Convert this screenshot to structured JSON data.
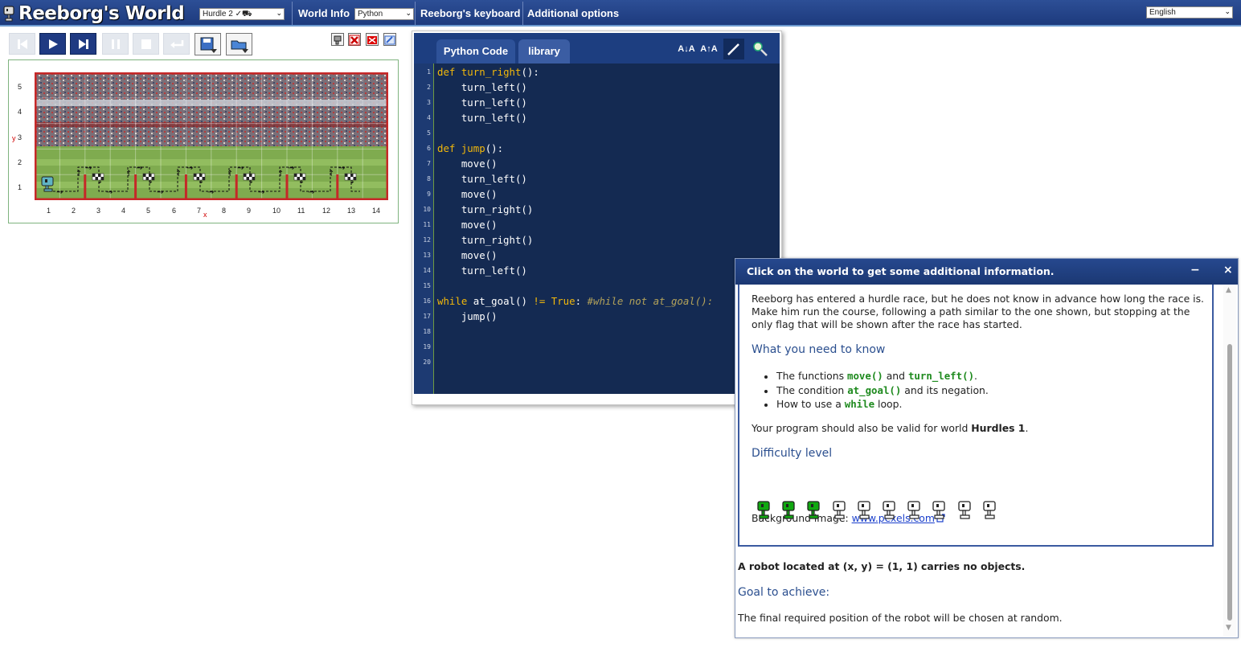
{
  "topbar": {
    "app_title": "Reeborg's World",
    "world_select": "Hurdle 2 ✓⛟",
    "world_info": "World Info",
    "language_select": "Python",
    "keyboard": "Reeborg's keyboard",
    "options": "Additional options",
    "ui_language": "English"
  },
  "controls": {
    "icons": [
      "reverse-step-icon",
      "run-icon",
      "step-icon",
      "pause-icon",
      "stop-icon",
      "reload-icon",
      "save-world-icon",
      "open-world-icon"
    ]
  },
  "world": {
    "y_ticks": [
      "5",
      "4",
      "3",
      "2",
      "1"
    ],
    "y_axis_label": "y",
    "x_ticks": [
      "1",
      "2",
      "3",
      "4",
      "5",
      "6",
      "7",
      "8",
      "9",
      "10",
      "11",
      "12",
      "13",
      "14"
    ],
    "x_axis_label": "x"
  },
  "editor": {
    "tab_code": "Python Code",
    "tab_library": "library",
    "tools": [
      "A↓A",
      "A↑A"
    ],
    "line_numbers": [
      "1",
      "2",
      "3",
      "4",
      "5",
      "6",
      "7",
      "8",
      "9",
      "10",
      "11",
      "12",
      "13",
      "14",
      "15",
      "16",
      "17",
      "18",
      "19",
      "20"
    ]
  },
  "code": {
    "l1_kw": "def",
    "l1_rest": " turn_right",
    "l1_end": "():",
    "l2": "    turn_left()",
    "l3": "    turn_left()",
    "l4": "    turn_left()",
    "l6_kw": "def",
    "l6_rest": " jump",
    "l6_end": "():",
    "l7": "    move()",
    "l8": "    turn_left()",
    "l9": "    move()",
    "l10": "    turn_right()",
    "l11": "    move()",
    "l12": "    turn_right()",
    "l13": "    move()",
    "l14": "    turn_left()",
    "l16_kw": "while",
    "l16_mid": " at_goal() ",
    "l16_op": "!=",
    "l16_true": " True",
    "l16_colon": ":",
    "l16_comment": " #while not at_goal():",
    "l17": "    jump()"
  },
  "dialog": {
    "title": "Click on the world to get some additional information.",
    "minimize": "−",
    "close": "×",
    "intro_1": "Reeborg has entered a hurdle race, but he does not know in advance how long the race is.",
    "intro_2": "Make him run the course, following a path similar to the one shown, but stopping at the",
    "intro_3": "only flag that will be shown after the race has started.",
    "need_heading": "What you need to know",
    "b1_a": "The functions ",
    "b1_code1": "move()",
    "b1_b": " and ",
    "b1_code2": "turn_left()",
    "b1_c": ".",
    "b2_a": "The condition ",
    "b2_code": "at_goal()",
    "b2_b": " and its negation.",
    "b3_a": "How to use a ",
    "b3_code": "while",
    "b3_b": " loop.",
    "valid_a": "Your program should also be valid for world ",
    "valid_world": "Hurdles 1",
    "valid_b": ".",
    "difficulty_heading": "Difficulty level",
    "difficulty": 3,
    "difficulty_max": 10,
    "bg_label": "Background image: ",
    "bg_link": "www.pexels.com",
    "robot_info": "A robot located at (x, y) = (1, 1) carries no objects.",
    "goal_heading": "Goal to achieve:",
    "goal_text": "The final required position of the robot will be chosen at random.",
    "colors": {
      "title_bar": "#1f3d7f",
      "heading": "#2b4f8f",
      "code_green": "#1e8a1e",
      "difficulty_on": "#11a811"
    }
  }
}
